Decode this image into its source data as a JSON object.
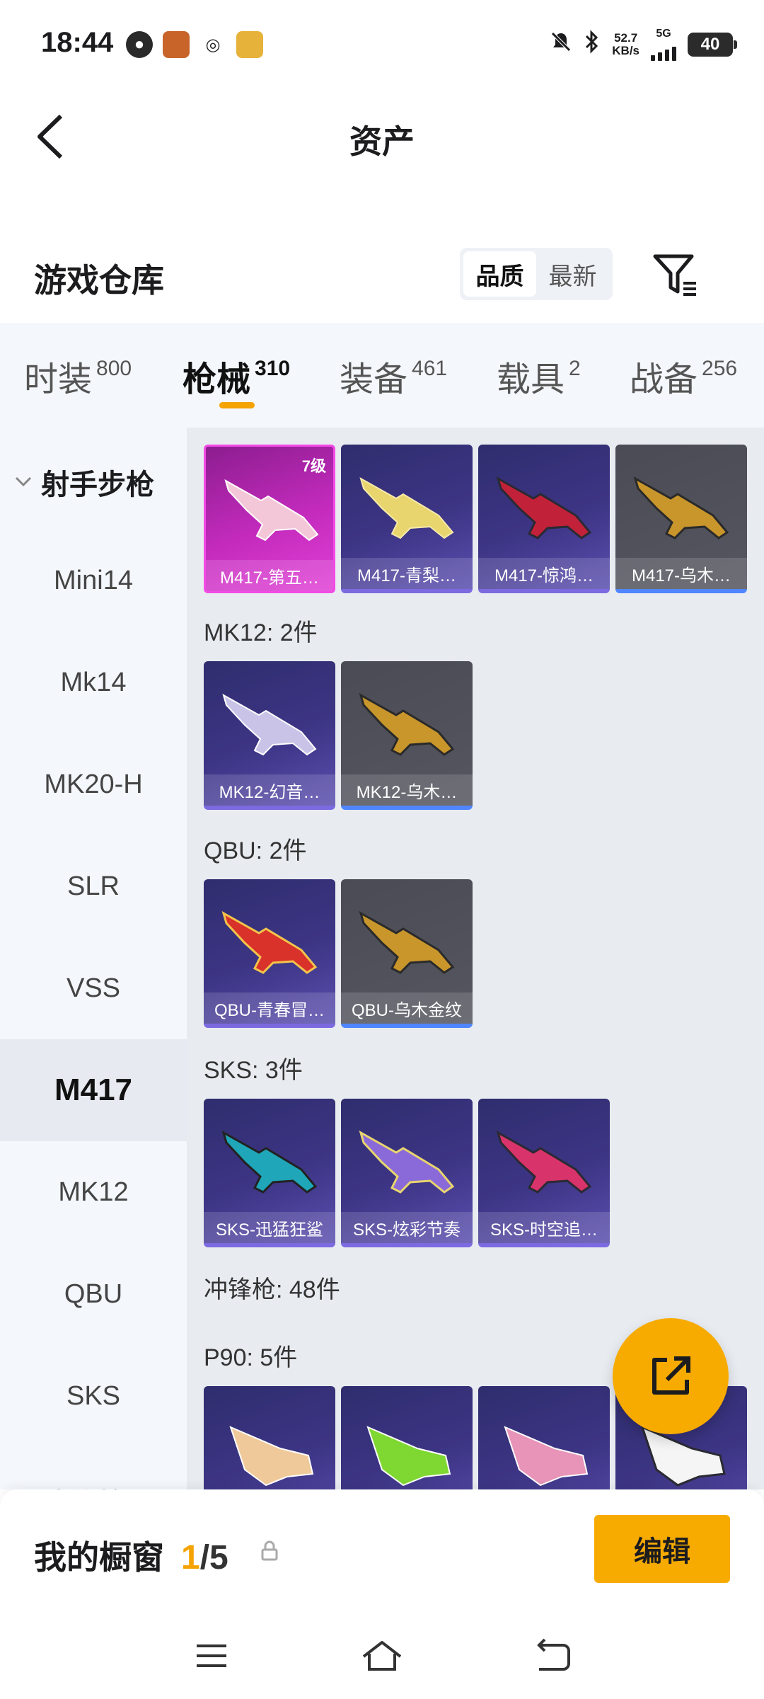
{
  "status_bar": {
    "time": "18:44",
    "net_speed_value": "52.7",
    "net_speed_unit": "KB/s",
    "network": "5G",
    "battery": "40"
  },
  "header": {
    "title": "资产"
  },
  "warehouse": {
    "title": "游戏仓库",
    "sort_options": [
      "品质",
      "最新"
    ],
    "active_sort": "品质"
  },
  "category_tabs": [
    {
      "label": "时装",
      "count": "800"
    },
    {
      "label": "枪械",
      "count": "310",
      "active": true
    },
    {
      "label": "装备",
      "count": "461"
    },
    {
      "label": "载具",
      "count": "2"
    },
    {
      "label": "战备",
      "count": "256"
    }
  ],
  "sidebar": {
    "group": "射手步枪",
    "items": [
      "Mini14",
      "Mk14",
      "MK20-H",
      "SLR",
      "VSS",
      "M417",
      "MK12",
      "QBU",
      "SKS"
    ],
    "active": "M417",
    "next_group_partial": "冲锋枪"
  },
  "sections": {
    "m417_cards": [
      "M417-第五…",
      "M417-青梨…",
      "M417-惊鸿…",
      "M417-乌木…"
    ],
    "m417_badge": "7级",
    "mk12_header": "MK12: 2件",
    "mk12_cards": [
      "MK12-幻音…",
      "MK12-乌木…"
    ],
    "qbu_header": "QBU: 2件",
    "qbu_cards": [
      "QBU-青春冒…",
      "QBU-乌木金纹"
    ],
    "sks_header": "SKS: 3件",
    "sks_cards": [
      "SKS-迅猛狂鲨",
      "SKS-炫彩节奏",
      "SKS-时空追…"
    ],
    "smg_header": "冲锋枪: 48件",
    "p90_header": "P90: 5件"
  },
  "showcase": {
    "label": "我的橱窗",
    "current": "1",
    "total": "/5",
    "edit_label": "编辑"
  },
  "colors": {
    "accent": "#f7ab00",
    "purple_card": "#3d3585",
    "gray_card": "#55565f",
    "pink_card": "#c42bbd"
  }
}
